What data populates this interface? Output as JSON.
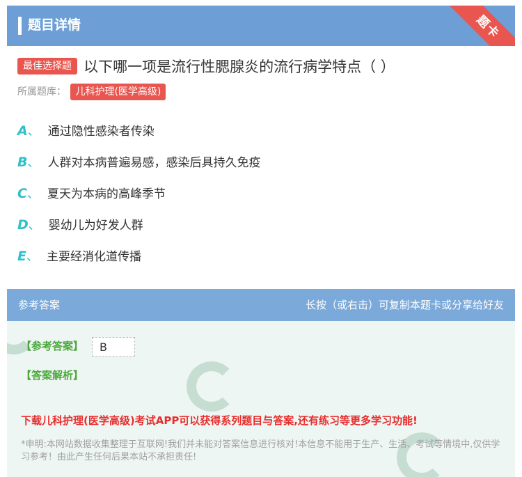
{
  "header": {
    "title": "题目详情",
    "corner_badge": "题卡"
  },
  "question": {
    "type_tag": "最佳选择题",
    "text": "以下哪一项是流行性腮腺炎的流行病学特点（ ）",
    "library_label": "所属题库：",
    "library_name": "儿科护理(医学高级)"
  },
  "options": [
    {
      "letter": "A",
      "sep": "、",
      "text": "通过隐性感染者传染"
    },
    {
      "letter": "B",
      "sep": "、",
      "text": "人群对本病普遍易感，感染后具持久免疫"
    },
    {
      "letter": "C",
      "sep": "、",
      "text": "夏天为本病的高峰季节"
    },
    {
      "letter": "D",
      "sep": "、",
      "text": "婴幼儿为好发人群"
    },
    {
      "letter": "E",
      "sep": "、",
      "text": "主要经消化道传播"
    }
  ],
  "answer_section": {
    "title": "参考答案",
    "hint": "长按（或右击）可复制本题卡或分享给好友",
    "answer_label": "【参考答案】",
    "answer_value": "B",
    "explanation_label": "【答案解析】",
    "promo": "下载儿科护理(医学高级)考试APP可以获得系列题目与答案,还有练习等更多学习功能!",
    "disclaimer": "*申明:本网站数据收集整理于互联网!我们并未能对答案信息进行核对!本信息不能用于生产、生活、考试等情境中,仅供学习参考！由此产生任何后果本站不承担责任!"
  },
  "colors": {
    "header_bg": "#6d9fd6",
    "accent_red": "#e8564f",
    "option_letter": "#2fc0ca",
    "answer_green": "#4aa83b"
  }
}
